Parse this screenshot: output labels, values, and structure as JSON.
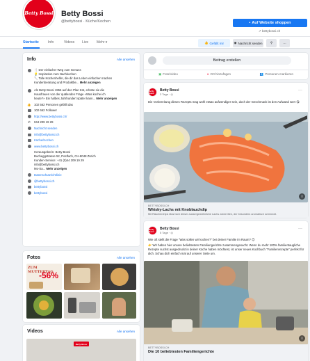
{
  "header": {
    "logo_text": "Betty Bossi",
    "page_name": "Betty Bossi",
    "handle": "@bettybossi · Küche/Kochen",
    "cta_label": "Auf Website shoppen",
    "cta_link": "bettybossi.ch"
  },
  "nav": {
    "tabs": [
      "Startseite",
      "Info",
      "Videos",
      "Live",
      "Mehr ▾"
    ],
    "like_label": "Gefällt mir",
    "message_label": "Nachricht senden",
    "search_glyph": "⚲",
    "more_glyph": "···"
  },
  "info": {
    "title": "Info",
    "see_all": "Alle ansehen",
    "lines": [
      "Der einfacher Weg zum Genuss",
      "Inspiration zum Nachkochen",
      "Tolle Küchenhelfer, die dir das Leben einfacher machen"
    ],
    "lines_tail": "Kundenberatung und Produktbe...",
    "more_label": "Mehr anzeigen",
    "history_1": "Als Betty Bossi 1956 auf den Plan trat, erlöste sie die",
    "history_2": "Hausfrauen von der quälenden Frage «Was koche ich",
    "history_3": "heute?» Ein halbes Jahrhundert später kann...",
    "history_more": "Mehr anzeigen",
    "likes": "102 562 Personen gefällt das",
    "followers": "102 662 Follower",
    "website": "http://www.bettybossi.ch/",
    "phone": "044 209 19 29",
    "message": "Nachricht senden",
    "email": "info@bettybossi.ch",
    "category": "Küche/Kochen",
    "url2": "www.bettybossi.ch",
    "imprint": [
      "Herausgeberin: Betty Bossi",
      "Bucheggstrasse 52, Postfach, CH-8048 Zürich",
      "Kunden-Service: +41 (0)44 209 19 29",
      "info@bettybossi.ch"
    ],
    "imprint_tail": "Mo-Sa...",
    "imprint_more": "Mehr anzeigen",
    "privacy": "Datenschutzrichtlinie",
    "instagram": "@bettybossi.ch",
    "social_1": "bettybossi",
    "social_2": "bettybossi"
  },
  "photos": {
    "title": "Fotos",
    "see_all": "Alle ansehen",
    "overlay_text": "ZUM MUTTERTAG",
    "discount": "-56%"
  },
  "videos": {
    "title": "Videos",
    "see_all": "Alle ansehen",
    "logo_text": "Betty Bossi"
  },
  "composer": {
    "placeholder": "Beitrag erstellen",
    "photo_video": "Foto/Video",
    "checkin": "Ort hinzufügen",
    "tag": "Personen markieren"
  },
  "posts": [
    {
      "author": "Betty Bossi",
      "time": "3 Tage · ◎",
      "text": "Die Vorbereitung dieses Rezepts mag wohl etwas aufwendiger sein, doch der Geschmack ist den Aufwand wert 😋",
      "link_domain": "BETTYBOSSI.CH",
      "link_title": "Whisky-Lachs mit Knoblauchdip",
      "link_desc": "Mit Räucherchips lässt sich dieser aussergewöhnliche Lachs zubereiten, der besonders aromatisch schmeckt."
    },
    {
      "author": "Betty Bossi",
      "time": "5 Tage · ◎",
      "text_1": "Wie oft stellt die Frage \"Was sollen wir kochen?\" bei deiner Familie im Raum? 😊",
      "text_2": "👉 Wir haben hier unsere beliebtesten Familiengerichte zusammengesucht. Wenn du mehr 100% familientaugliche Rezepte suchst ausgedruckt in deiner Küche haben möchtest, ist unser neues Kochbuch \"Familienrezepte\" perfekt für dich. Schau dich einfach mal auf unserer Seite um.",
      "link_domain": "BETTYBOSSI.CH",
      "link_title": "Die 10 beliebtesten Familiengerichte"
    }
  ]
}
